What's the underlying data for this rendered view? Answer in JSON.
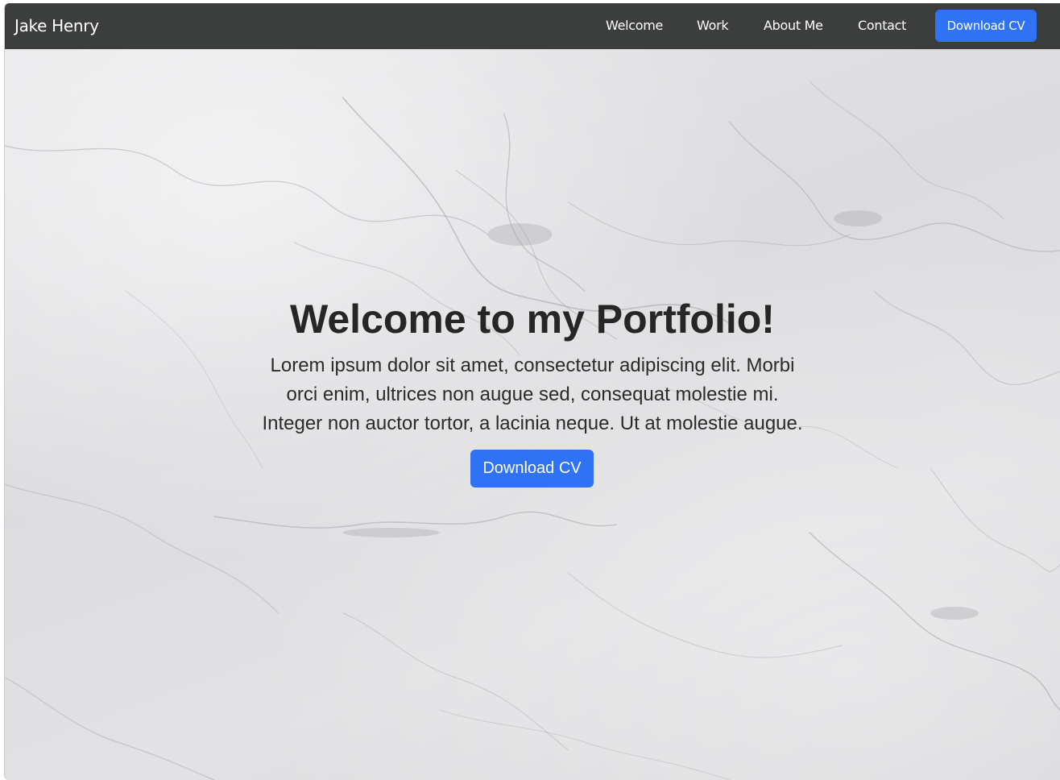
{
  "navbar": {
    "brand": "Jake Henry",
    "links": [
      {
        "label": "Welcome"
      },
      {
        "label": "Work"
      },
      {
        "label": "About Me"
      },
      {
        "label": "Contact"
      }
    ],
    "cta_label": "Download CV"
  },
  "hero": {
    "title": "Welcome to my Portfolio!",
    "text": "Lorem ipsum dolor sit amet, consectetur adipiscing elit. Morbi orci enim, ultrices non augue sed, consequat molestie mi. Integer non auctor tortor, a lacinia neque. Ut at molestie augue.",
    "button_label": "Download CV"
  },
  "colors": {
    "navbar_bg": "#3c3d3d",
    "accent": "#2f72f4",
    "text": "#262626",
    "hero_bg": "#e0e0e2"
  }
}
